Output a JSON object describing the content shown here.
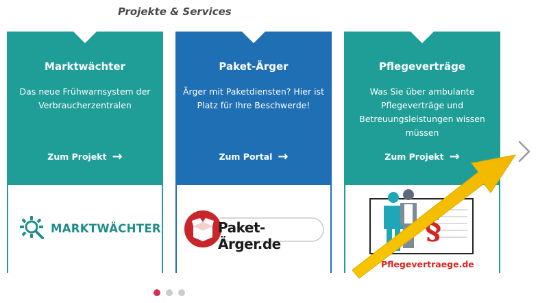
{
  "section": {
    "title": "Projekte & Services"
  },
  "cards": [
    {
      "title": "Marktwächter",
      "description": "Das neue Frühwarnsystem der Verbraucherzentralen",
      "cta": "Zum Projekt",
      "logo_text": "MARKTWÄCHTER",
      "color": "#1f9e98"
    },
    {
      "title": "Paket-Ärger",
      "description": "Ärger mit Paketdiensten? Hier ist Platz für Ihre Beschwerde!",
      "cta": "Zum Portal",
      "logo_text": "Paket-Ärger.de",
      "color": "#1f6fb5"
    },
    {
      "title": "Pflegeverträge",
      "description": "Was Sie über ambulante Pflegeverträge und Betreuungsleistungen wissen müssen",
      "cta": "Zum Projekt",
      "logo_text": "Pflegevertraege.de",
      "color": "#1f9e98"
    }
  ],
  "carousel": {
    "next_icon": "chevron-right-icon",
    "dots": [
      "active",
      "inactive",
      "inactive"
    ],
    "active_color": "#d0324f",
    "inactive_color": "#cccccc"
  },
  "annotation": {
    "arrow_color": "#f5c400"
  }
}
